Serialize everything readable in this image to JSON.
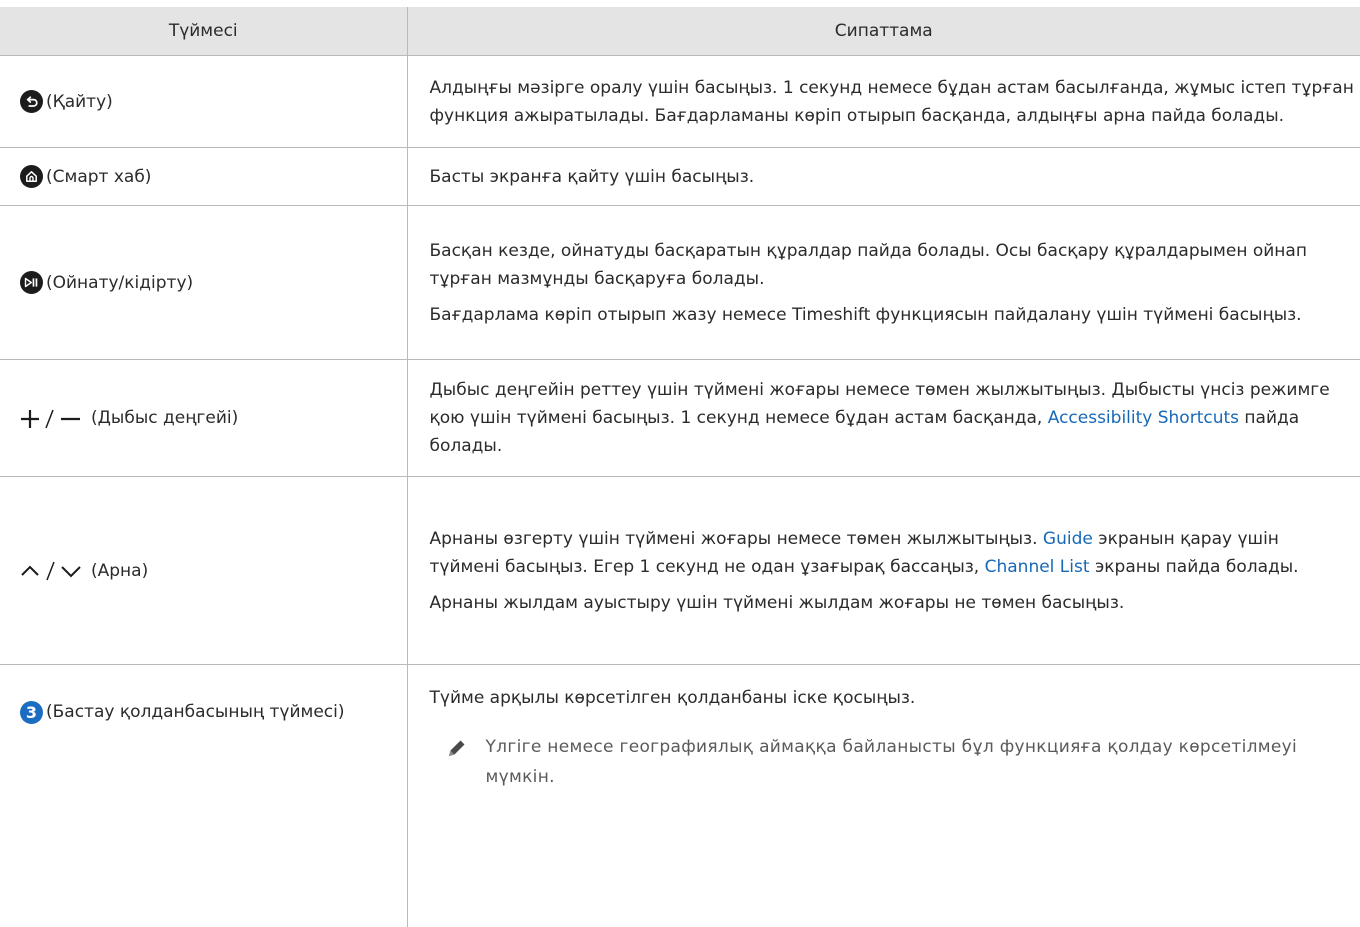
{
  "header": {
    "col1": "Түймесі",
    "col2": "Сипаттама"
  },
  "rows": [
    {
      "icon": "return-icon",
      "button": "(Қайту)",
      "desc": [
        "Алдыңғы мәзірге оралу үшін басыңыз. 1 секунд немесе бұдан астам басылғанда, жұмыс істеп тұрған функция ажыратылады. Бағдарламаны көріп отырып басқанда, алдыңғы арна пайда болады."
      ]
    },
    {
      "icon": "home-icon",
      "button": "(Смарт хаб)",
      "desc": [
        "Басты экранға қайту үшін басыңыз."
      ]
    },
    {
      "icon": "play-pause-icon",
      "button": "(Ойнату/кідірту)",
      "desc": [
        "Басқан кезде, ойнатуды басқаратын құралдар пайда болады. Осы басқару құралдарымен ойнап тұрған мазмұнды басқаруға болады.",
        "Бағдарлама көріп отырып жазу немесе Timeshift функциясын пайдалану үшін түймені басыңыз."
      ]
    },
    {
      "icon": "volume-plus-minus-icon",
      "button": "(Дыбыс деңгейі)",
      "desc_a": "Дыбыс деңгейін реттеу үшін түймені жоғары немесе төмен жылжытыңыз. Дыбысты үнсіз режимге қою үшін түймені басыңыз. 1 секунд немесе бұдан астам басқанда,",
      "desc_link": "Accessibility Shortcuts",
      "desc_b": "пайда болады."
    },
    {
      "icon": "channel-up-down-icon",
      "button": "(Арна)",
      "desc_a": "Арнаны өзгерту үшін түймені жоғары немесе төмен жылжытыңыз.",
      "desc_link1": "Guide",
      "desc_b": "экранын қарау үшін түймені басыңыз. Егер 1 секунд не одан ұзағырақ бассаңыз,",
      "desc_link2": "Channel List",
      "desc_c": "экраны пайда болады.",
      "desc2": "Арнаны жылдам ауыстыру үшін түймені жылдам жоғары не төмен басыңыз."
    },
    {
      "icon": "number-3-icon",
      "icon_text": "3",
      "button": "(Бастау қолданбасының түймесі)",
      "desc": [
        "Түйме арқылы көрсетілген қолданбаны іске қосыңыз."
      ],
      "note": "Үлгіге немесе географиялық аймаққа байланысты бұл функцияға қолдау көрсетілмеуі мүмкін."
    }
  ],
  "colors": {
    "header_bg": "#e4e4e4",
    "border": "#b9b9b9",
    "link": "#1769b8",
    "badge": "#1b6dc1"
  }
}
